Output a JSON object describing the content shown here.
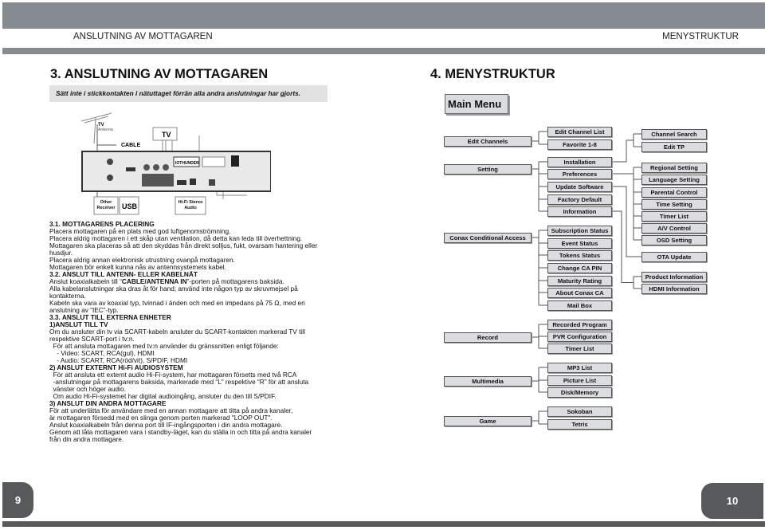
{
  "header": {
    "left_title": "ANSLUTNING AV MOTTAGAREN",
    "right_title": "MENYSTRUKTUR"
  },
  "left": {
    "title": "3. ANSLUTNING AV MOTTAGAREN",
    "warning": "Sätt inte i stickkontakten i nätuttaget förrän alla andra anslutningar har gjorts.",
    "diagram": {
      "tv_antenna": "TV",
      "antenna": "Antenna",
      "cable": "CABLE",
      "tv": "TV",
      "other_receiver": "Other Receiver",
      "usb": "USB",
      "hifi": "Hi-Fi Stereo Audio",
      "logo": "IOTHUNDER"
    },
    "lines": [
      [
        {
          "t": "3.1. MOTTAGARENS PLACERING",
          "b": true
        }
      ],
      [
        {
          "t": "Placera mottagaren på en plats med god luftgenomströmning."
        }
      ],
      [
        {
          "t": "Placera aldrig mottagaren i ett skåp utan ventilation, då detta kan leda till överhettning."
        }
      ],
      [
        {
          "t": "Mottagaren ska placeras så att den skyddas från direkt solljus, fukt, ovarsam hantering eller"
        }
      ],
      [
        {
          "t": "husdjur."
        }
      ],
      [
        {
          "t": "Placera aldrig annan elektronisk utrustning ovanpå mottagaren."
        }
      ],
      [
        {
          "t": "Mottagaren bör enkelt kunna nås av antennsystemets kabel."
        }
      ],
      [
        {
          "t": "3.2. ANSLUT TILL ANTENN- ELLER KABELNÄT",
          "b": true
        }
      ],
      [
        {
          "t": "Anslut koaxialkabeln till “"
        },
        {
          "t": "CABLE/ANTENNA IN",
          "b": true
        },
        {
          "t": "”-porten på mottagarens baksida."
        }
      ],
      [
        {
          "t": "Alla kabelanslutningar ska dras åt för hand; använd inte någon typ av skruvmejsel på"
        }
      ],
      [
        {
          "t": "kontakterna."
        }
      ],
      [
        {
          "t": "Kabeln ska vara av koaxial typ, tvinnad i änden och med en impedans på 75 Ω, med en"
        }
      ],
      [
        {
          "t": "anslutning av “IEC”-typ."
        }
      ],
      [
        {
          "t": "3.3. ANSLUT TILL EXTERNA ENHETER",
          "b": true
        }
      ],
      [
        {
          "t": "1)ANSLUT TILL TV",
          "b": true
        }
      ],
      [
        {
          "t": "Om du ansluter din tv via SCART-kabeln ansluter du SCART-kontakten markerad TV till"
        }
      ],
      [
        {
          "t": "respektive SCART-port i tv:n."
        }
      ],
      [
        {
          "t": "  För att ansluta mottagaren med tv:n använder du gränssnitten enligt följande:"
        }
      ],
      [
        {
          "t": "    - Video: SCART, RCA(gul), HDMI"
        }
      ],
      [
        {
          "t": "    - Audio: SCART, RCA(röd/vit), S/PDIF, HDMI"
        }
      ],
      [
        {
          "t": "2) ANSLUT EXTERNT Hi-Fi AUDIOSYSTEM",
          "b": true
        }
      ],
      [
        {
          "t": "  För att ansluta ett externt audio Hi-Fi-system, har mottagaren försetts med två RCA"
        }
      ],
      [
        {
          "t": "  -anslutningar på mottagarens baksida, markerade med “L” respektive “R” för att ansluta"
        }
      ],
      [
        {
          "t": "  vänster och höger audio."
        }
      ],
      [
        {
          "t": "  Om audio Hi-Fi-systemet har digital audioingång, ansluter du den till S/PDIF."
        }
      ],
      [
        {
          "t": "3) ANSLUT DIN ANDRA MOTTAGARE",
          "b": true
        }
      ],
      [
        {
          "t": "För att underlätta för användare med en annan mottagare att titta på andra kanaler,"
        }
      ],
      [
        {
          "t": "är mottagaren försedd med en slinga genom porten markerad \"LOOP OUT\"."
        }
      ],
      [
        {
          "t": "Anslut koaxialkabeln från denna port till IF-ingångsporten i din andra mottagare."
        }
      ],
      [
        {
          "t": "Genom att låta mottagaren vara i standby-läget, kan du ställa in och titta på andra kanaler"
        }
      ],
      [
        {
          "t": "från din andra mottagare."
        }
      ]
    ]
  },
  "right": {
    "title": "4. MENYSTRUKTUR",
    "main_menu": "Main Menu",
    "menu": [
      {
        "label": "Edit Channels",
        "children": [
          {
            "label": "Edit Channel List"
          },
          {
            "label": "Favorite 1-8"
          }
        ]
      },
      {
        "label": "Setting",
        "children": [
          {
            "label": "Installation",
            "children": [
              "Channel Search",
              "Edit TP"
            ]
          },
          {
            "label": "Preferences",
            "children": [
              "Regional Setting",
              "Language Setting",
              "Parental Control",
              "Time Setting",
              "Timer List",
              "A/V Control",
              "OSD Setting"
            ]
          },
          {
            "label": "Update Software",
            "children": [
              "OTA Update"
            ]
          },
          {
            "label": "Factory Default"
          },
          {
            "label": "Information",
            "children": [
              "Product Information",
              "HDMI Information"
            ]
          }
        ]
      },
      {
        "label": "Conax Conditional Access",
        "children": [
          {
            "label": "Subscription Status"
          },
          {
            "label": "Event Status"
          },
          {
            "label": "Tokens Status"
          },
          {
            "label": "Change CA PIN"
          },
          {
            "label": "Maturity Rating"
          },
          {
            "label": "About Conax CA"
          },
          {
            "label": "Mail Box"
          }
        ]
      },
      {
        "label": "Record",
        "children": [
          {
            "label": "Recorded Program"
          },
          {
            "label": "PVR Configuration"
          },
          {
            "label": "Timer List"
          }
        ]
      },
      {
        "label": "Multimedia",
        "children": [
          {
            "label": "MP3 List"
          },
          {
            "label": "Picture List"
          },
          {
            "label": "Disk/Memory"
          }
        ]
      },
      {
        "label": "Game",
        "children": [
          {
            "label": "Sokoban"
          },
          {
            "label": "Tetris"
          }
        ]
      }
    ]
  },
  "footer": {
    "left_page": "9",
    "right_page": "10"
  }
}
